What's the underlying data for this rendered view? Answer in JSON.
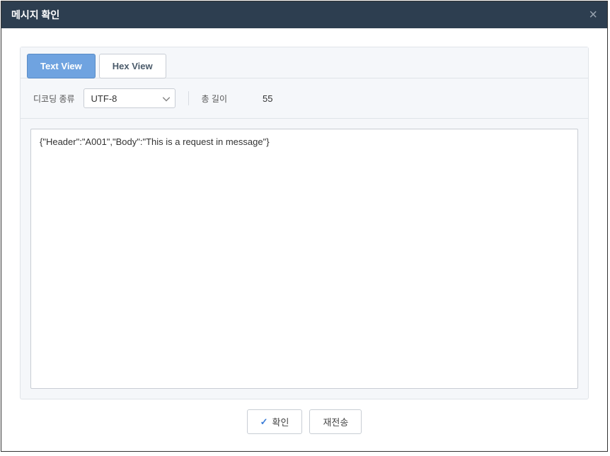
{
  "header": {
    "title": "메시지 확인",
    "close": "×"
  },
  "tabs": {
    "textView": "Text View",
    "hexView": "Hex View"
  },
  "controls": {
    "decodeLabel": "디코딩 종류",
    "decodeValue": "UTF-8",
    "lengthLabel": "총 길이",
    "lengthValue": "55"
  },
  "content": "{\"Header\":\"A001\",\"Body\":\"This is a request in message\"}",
  "footer": {
    "confirm": "확인",
    "resend": "재전송"
  }
}
